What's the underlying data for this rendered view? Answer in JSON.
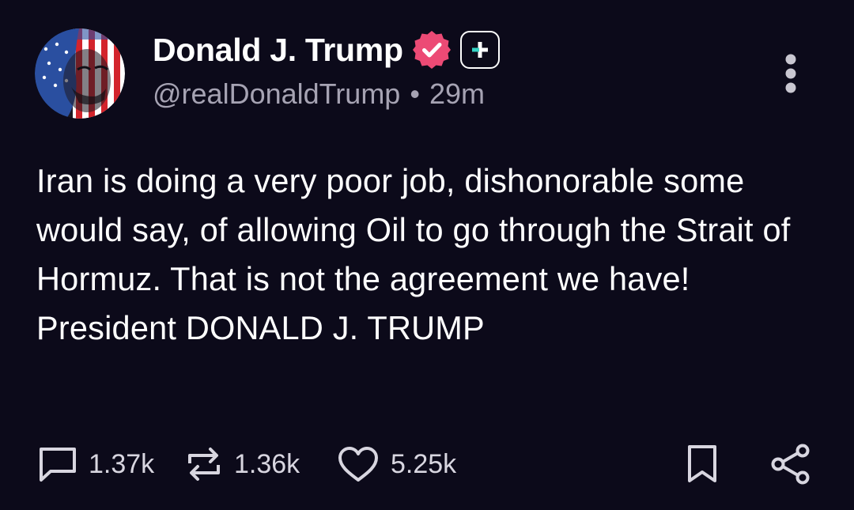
{
  "author": {
    "display_name": "Donald J. Trump",
    "handle": "@realDonaldTrump",
    "separator": "•",
    "time_ago": "29m",
    "verified": true,
    "avatar_icon": "flag-portrait-avatar"
  },
  "post": {
    "text": "Iran is doing a very poor job, dishonorable some would say, of allowing Oil to go through the Strait of Hormuz. That is not the agreement we have! President DONALD J. TRUMP"
  },
  "actions": {
    "replies": "1.37k",
    "reposts": "1.36k",
    "likes": "5.25k"
  },
  "icons": {
    "verified": "verified-badge-icon",
    "subscribe": "plus-icon",
    "more": "more-vertical-icon",
    "reply": "comment-icon",
    "repost": "repost-icon",
    "like": "heart-icon",
    "bookmark": "bookmark-icon",
    "share": "share-icon"
  },
  "colors": {
    "background": "#0c0a1a",
    "verified_badge": "#ec4a75",
    "plus_accent": "#35d3c4",
    "secondary_text": "#a6a3b3"
  }
}
